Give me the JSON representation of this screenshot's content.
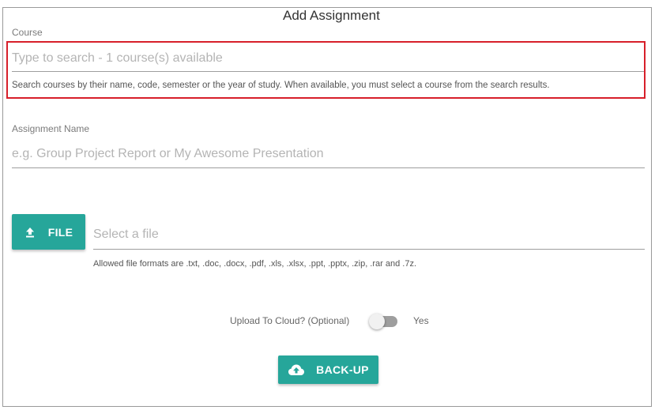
{
  "form": {
    "title": "Add Assignment"
  },
  "course": {
    "label": "Course",
    "placeholder": "Type to search - 1 course(s) available",
    "value": "",
    "helper": "Search courses by their name, code, semester or the year of study. When available, you must select a course from the search results."
  },
  "assignment_name": {
    "label": "Assignment Name",
    "placeholder": "e.g. Group Project Report or My Awesome Presentation",
    "value": ""
  },
  "file": {
    "button_label": "FILE",
    "button_icon": "upload-icon",
    "placeholder": "Select a file",
    "helper": "Allowed file formats are .txt, .doc, .docx, .pdf, .xls, .xlsx, .ppt, .pptx, .zip, .rar and .7z."
  },
  "cloud_upload": {
    "label": "Upload To Cloud? (Optional)",
    "on_label": "Yes",
    "enabled": false
  },
  "backup_button": {
    "label": "BACK-UP",
    "icon": "cloud-upload-icon"
  },
  "colors": {
    "accent": "#26a69a",
    "highlight": "#d71f2a",
    "border": "#9a9a9a"
  }
}
